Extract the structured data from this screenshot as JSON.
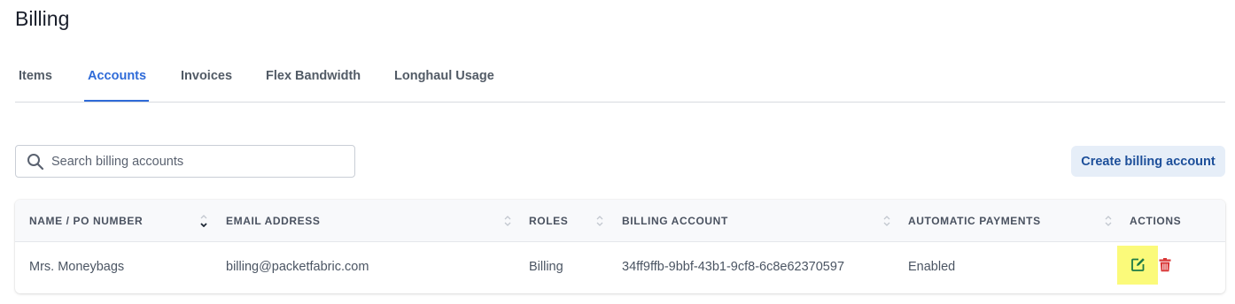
{
  "page": {
    "title": "Billing"
  },
  "tabs": [
    {
      "label": "Items"
    },
    {
      "label": "Accounts",
      "active": true
    },
    {
      "label": "Invoices"
    },
    {
      "label": "Flex Bandwidth"
    },
    {
      "label": "Longhaul Usage"
    }
  ],
  "search": {
    "placeholder": "Search billing accounts",
    "value": ""
  },
  "create_button": {
    "label": "Create billing account"
  },
  "table": {
    "columns": [
      "NAME / PO NUMBER",
      "EMAIL ADDRESS",
      "ROLES",
      "BILLING ACCOUNT",
      "AUTOMATIC PAYMENTS",
      "ACTIONS"
    ],
    "rows": [
      {
        "name": "Mrs. Moneybags",
        "email": "billing@packetfabric.com",
        "roles": "Billing",
        "billing_account": "34ff9ffb-9bbf-43b1-9cf8-6c8e62370597",
        "automatic_payments": "Enabled"
      }
    ]
  },
  "colors": {
    "accent": "#2f6bd8",
    "edit_highlight": "#fbfa7a",
    "edit_icon": "#1e7a47",
    "delete_icon": "#d93636"
  },
  "icons": [
    "search-icon",
    "sort-icon",
    "chevron-down-icon",
    "edit-icon",
    "trash-icon"
  ]
}
